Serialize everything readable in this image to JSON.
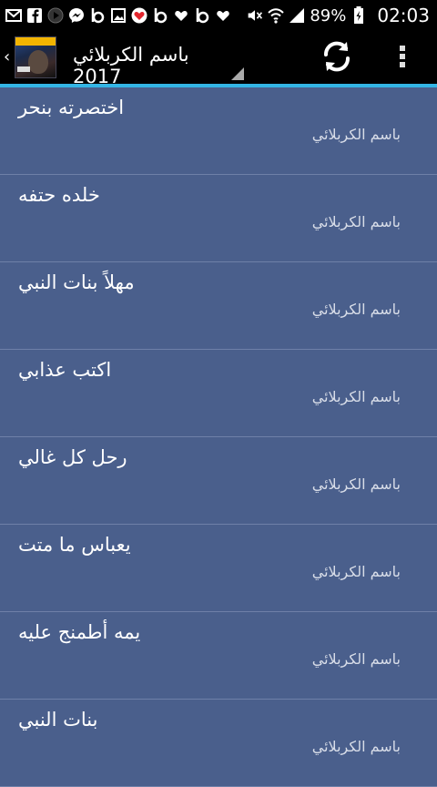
{
  "statusbar": {
    "battery": "89%",
    "time": "02:03"
  },
  "actionbar": {
    "title": "باسم الكربلائي 2017"
  },
  "list": {
    "items": [
      {
        "title": "اختصرته بنحر",
        "subtitle": "باسم الكربلائي"
      },
      {
        "title": "خلده حتفه",
        "subtitle": "باسم الكربلائي"
      },
      {
        "title": "مهلاً بنات النبي",
        "subtitle": "باسم الكربلائي"
      },
      {
        "title": "اكتب عذابي",
        "subtitle": "باسم الكربلائي"
      },
      {
        "title": "رحل كل غالي",
        "subtitle": "باسم الكربلائي"
      },
      {
        "title": "يعباس ما متت",
        "subtitle": "باسم الكربلائي"
      },
      {
        "title": "يمه أطمنج عليه",
        "subtitle": "باسم الكربلائي"
      },
      {
        "title": "بنات النبي",
        "subtitle": "باسم الكربلائي"
      }
    ]
  }
}
